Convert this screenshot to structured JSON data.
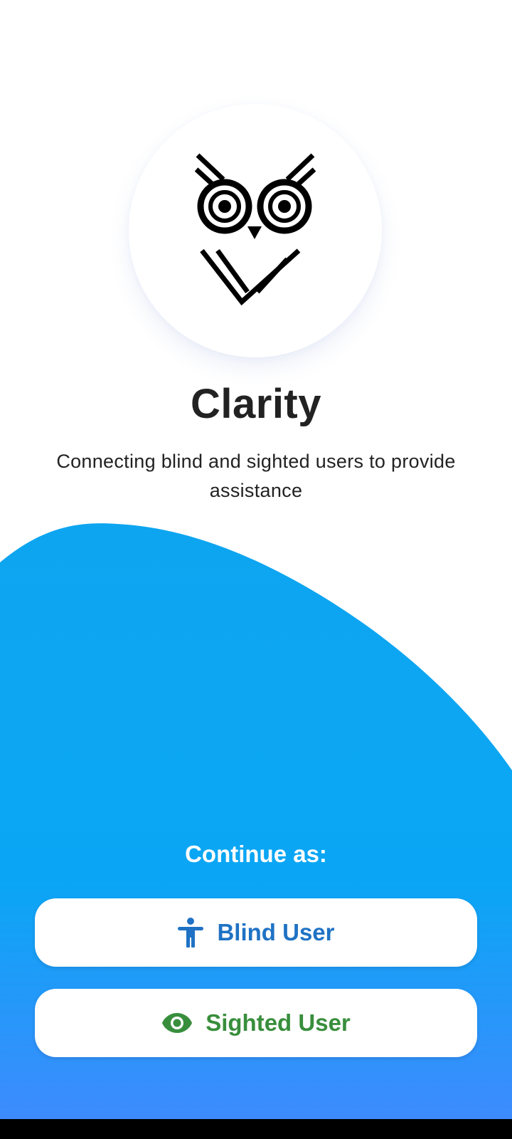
{
  "app": {
    "title": "Clarity",
    "subtitle": "Connecting blind and sighted users to provide assistance",
    "logo_icon": "owl-icon"
  },
  "continue_section": {
    "label": "Continue as:",
    "buttons": [
      {
        "label": "Blind User",
        "icon": "accessibility-icon",
        "color": "#1f72c4"
      },
      {
        "label": "Sighted User",
        "icon": "eye-icon",
        "color": "#388e3c"
      }
    ]
  },
  "theme": {
    "gradient_top": "#0ea5f0",
    "gradient_bottom": "#3d8bfd",
    "background": "#ffffff",
    "title_color": "#222222"
  }
}
